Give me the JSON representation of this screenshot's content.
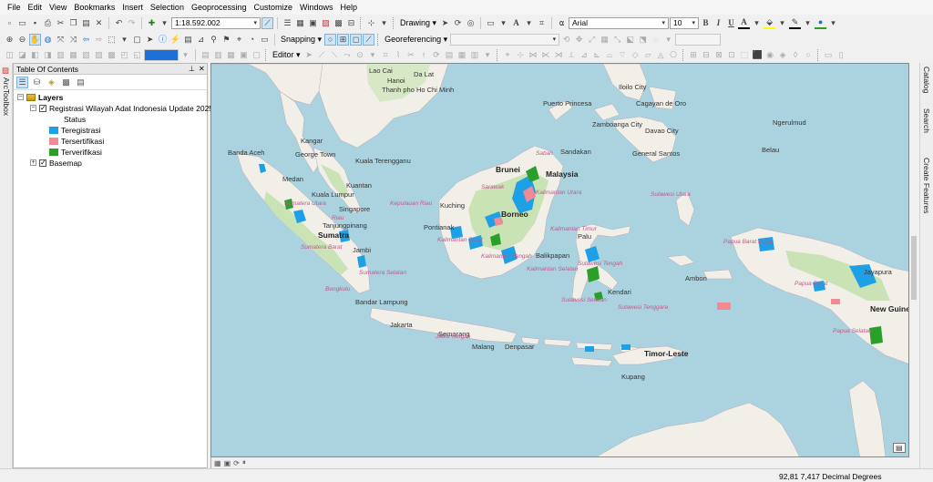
{
  "menu": [
    "File",
    "Edit",
    "View",
    "Bookmarks",
    "Insert",
    "Selection",
    "Geoprocessing",
    "Customize",
    "Windows",
    "Help"
  ],
  "toolbar": {
    "scale": "1:18.592.002",
    "drawing_label": "Drawing",
    "font_name": "Arial",
    "font_size": "10",
    "bold": "B",
    "italic": "I",
    "underline": "U",
    "text_tool": "A",
    "snapping_label": "Snapping",
    "georeferencing_label": "Georeferencing",
    "editor_label": "Editor"
  },
  "left_dock": {
    "arctoolbox": "ArcToolbox"
  },
  "toc": {
    "title": "Table Of Contents",
    "root": "Layers",
    "layer_name": "Registrasi Wilayah Adat Indonesia Update 2025",
    "field": "Status",
    "classes": [
      {
        "label": "Teregistrasi",
        "color": "#1ea0e6"
      },
      {
        "label": "Tersertifikasi",
        "color": "#f08a96"
      },
      {
        "label": "Terverifikasi",
        "color": "#2aa02a"
      }
    ],
    "basemap": "Basemap"
  },
  "right_dock": {
    "catalog": "Catalog",
    "search": "Search",
    "create_features": "Create Features"
  },
  "map_labels": {
    "places": [
      "Lao Cai",
      "Hanoi",
      "Da Lat",
      "Thanh pho Ho Chi Minh",
      "Puerto Princesa",
      "Iloilo City",
      "Cagayan de Oro",
      "Zamboanga City",
      "Davao City",
      "General Santos",
      "Banda Aceh",
      "Medan",
      "Kangar",
      "George Town",
      "Kuala Terengganu",
      "Kuantan",
      "Kuala Lumpur",
      "Singapore",
      "Tanjungpinang",
      "Jambi",
      "Bandar Lampung",
      "Jakarta",
      "Semarang",
      "Malang",
      "Denpasar",
      "Kupang",
      "Kuching",
      "Pontianak",
      "Sandakan",
      "Balikpapan",
      "Palu",
      "Kendari",
      "Ambon",
      "Jayapura",
      "Ngerulmud"
    ],
    "countries": [
      "Brunei",
      "Malaysia",
      "Borneo",
      "Sumatra",
      "New Guinea",
      "Timor-Leste",
      "Belau"
    ],
    "provinces": [
      "Sabah",
      "Sarawak",
      "Kalimantan Utara",
      "Kalimantan Timur",
      "Kalimantan Barat",
      "Kalimantan Tengah",
      "Kalimantan Selatan",
      "Sumatera Utara",
      "Sumatera Barat",
      "Sumatera Selatan",
      "Riau",
      "Kepulauan Riau",
      "Bengkulu",
      "Jawa Tengah",
      "Sulawesi Utara",
      "Sulawesi Tengah",
      "Sulawesi Selatan",
      "Sulawesi Tenggara",
      "Papua Barat Daya",
      "Papua Barat",
      "Papua Selatan"
    ]
  },
  "status": {
    "coords": "92,81  7,417 Decimal Degrees"
  },
  "colors": {
    "sea": "#aad3df",
    "land": "#f2efe9",
    "forest": "#c9e3b5",
    "teregistrasi": "#1ea0e6",
    "tersertifikasi": "#f08a96",
    "terverifikasi": "#2aa02a"
  }
}
